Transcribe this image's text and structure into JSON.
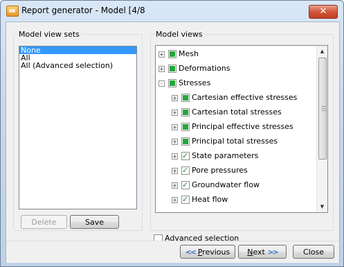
{
  "window": {
    "title": "Report generator - Model [4/8",
    "close_glyph": "✕"
  },
  "left_panel": {
    "legend": "Model view sets",
    "items": [
      "None",
      "All",
      "All (Advanced selection)"
    ],
    "delete_label": "Delete",
    "save_label": "Save"
  },
  "right_panel": {
    "legend": "Model views",
    "tree": [
      {
        "label": "Mesh",
        "state": "filled",
        "expander": "+"
      },
      {
        "label": "Deformations",
        "state": "filled",
        "expander": "+"
      },
      {
        "label": "Stresses",
        "state": "filled",
        "expander": "-"
      },
      {
        "label": "Cartesian effective stresses",
        "state": "filled",
        "expander": "+"
      },
      {
        "label": "Cartesian total stresses",
        "state": "filled",
        "expander": "+"
      },
      {
        "label": "Principal effective stresses",
        "state": "filled",
        "expander": "+"
      },
      {
        "label": "Principal total stresses",
        "state": "filled",
        "expander": "+"
      },
      {
        "label": "State parameters",
        "state": "check",
        "expander": "+"
      },
      {
        "label": "Pore pressures",
        "state": "check",
        "expander": "+"
      },
      {
        "label": "Groundwater flow",
        "state": "check",
        "expander": "+"
      },
      {
        "label": "Heat flow",
        "state": "check",
        "expander": "+"
      }
    ],
    "advanced_selection_label": "Advanced selection"
  },
  "footer": {
    "previous_label": "Previous",
    "previous_mnemonic": "P",
    "next_label": "Next",
    "next_mnemonic": "N",
    "close_label": "Close"
  },
  "colors": {
    "selection": "#3399ff",
    "node_green": "#25a53a",
    "close_red": "#c13f22"
  }
}
